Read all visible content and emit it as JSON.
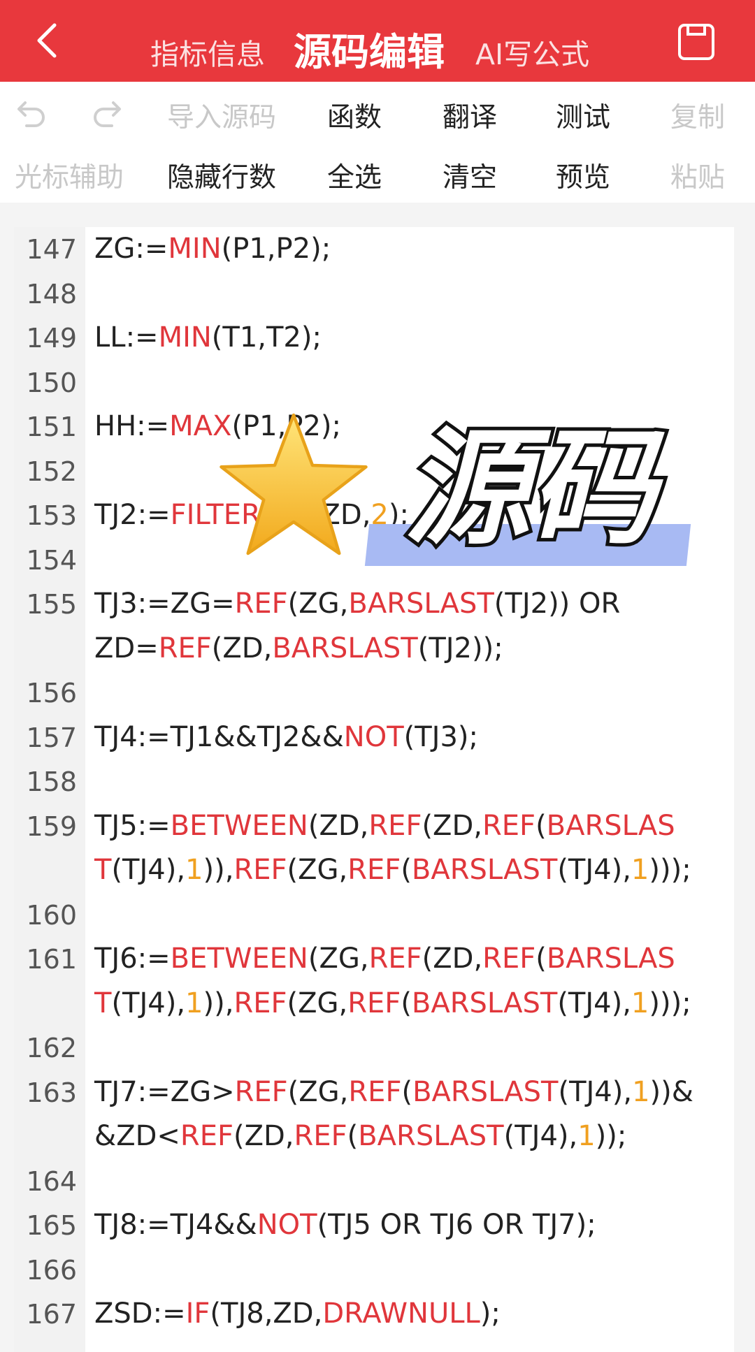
{
  "header": {
    "tabs": [
      {
        "label": "指标信息",
        "active": false
      },
      {
        "label": "源码编辑",
        "active": true
      },
      {
        "label": "AI写公式",
        "active": false
      }
    ],
    "back_icon": "chevron-left-icon",
    "save_icon": "save-icon",
    "bg_color": "#e8383d"
  },
  "toolbar": {
    "row1": {
      "undo_icon": "undo-icon",
      "redo_icon": "redo-icon",
      "import": "导入源码",
      "functions": "函数",
      "translate": "翻译",
      "test": "测试",
      "copy": "复制"
    },
    "row2": {
      "cursor_assist": "光标辅助",
      "hide_line_numbers": "隐藏行数",
      "select_all": "全选",
      "clear": "清空",
      "preview": "预览",
      "paste": "粘贴"
    }
  },
  "editor": {
    "lines": [
      {
        "num": "147",
        "text": "ZG:=MIN(P1,P2);"
      },
      {
        "num": "148",
        "text": ""
      },
      {
        "num": "149",
        "text": "LL:=MIN(T1,T2);"
      },
      {
        "num": "150",
        "text": ""
      },
      {
        "num": "151",
        "text": "HH:=MAX(P1,P2);"
      },
      {
        "num": "152",
        "text": ""
      },
      {
        "num": "153",
        "text": "TJ2:=FILTER(ZG,ZD,2);"
      },
      {
        "num": "154",
        "text": ""
      },
      {
        "num": "155",
        "text": "TJ3:=ZG=REF(ZG,BARSLAST(TJ2)) OR"
      },
      {
        "num": "",
        "text": "ZD=REF(ZD,BARSLAST(TJ2));"
      },
      {
        "num": "156",
        "text": ""
      },
      {
        "num": "157",
        "text": "TJ4:=TJ1&&TJ2&&NOT(TJ3);"
      },
      {
        "num": "158",
        "text": ""
      },
      {
        "num": "159",
        "text": "TJ5:=BETWEEN(ZD,REF(ZD,REF(BARSLAS"
      },
      {
        "num": "",
        "text": "T(TJ4),1)),REF(ZG,REF(BARSLAST(TJ4),1)));"
      },
      {
        "num": "160",
        "text": ""
      },
      {
        "num": "161",
        "text": "TJ6:=BETWEEN(ZG,REF(ZD,REF(BARSLAS"
      },
      {
        "num": "",
        "text": "T(TJ4),1)),REF(ZG,REF(BARSLAST(TJ4),1)));"
      },
      {
        "num": "162",
        "text": ""
      },
      {
        "num": "163",
        "text": "TJ7:=ZG>REF(ZG,REF(BARSLAST(TJ4),1))&"
      },
      {
        "num": "",
        "text": "&ZD<REF(ZD,REF(BARSLAST(TJ4),1));"
      },
      {
        "num": "164",
        "text": ""
      },
      {
        "num": "165",
        "text": "TJ8:=TJ4&&NOT(TJ5 OR TJ6 OR TJ7);"
      },
      {
        "num": "166",
        "text": ""
      },
      {
        "num": "167",
        "text": "ZSD:=IF(TJ8,ZD,DRAWNULL);"
      }
    ],
    "function_color": "#e0363b",
    "number_color": "#f0a020"
  },
  "overlay": {
    "star_icon": "star-icon",
    "caption": "源码",
    "highlight_color": "#a8baf3"
  }
}
